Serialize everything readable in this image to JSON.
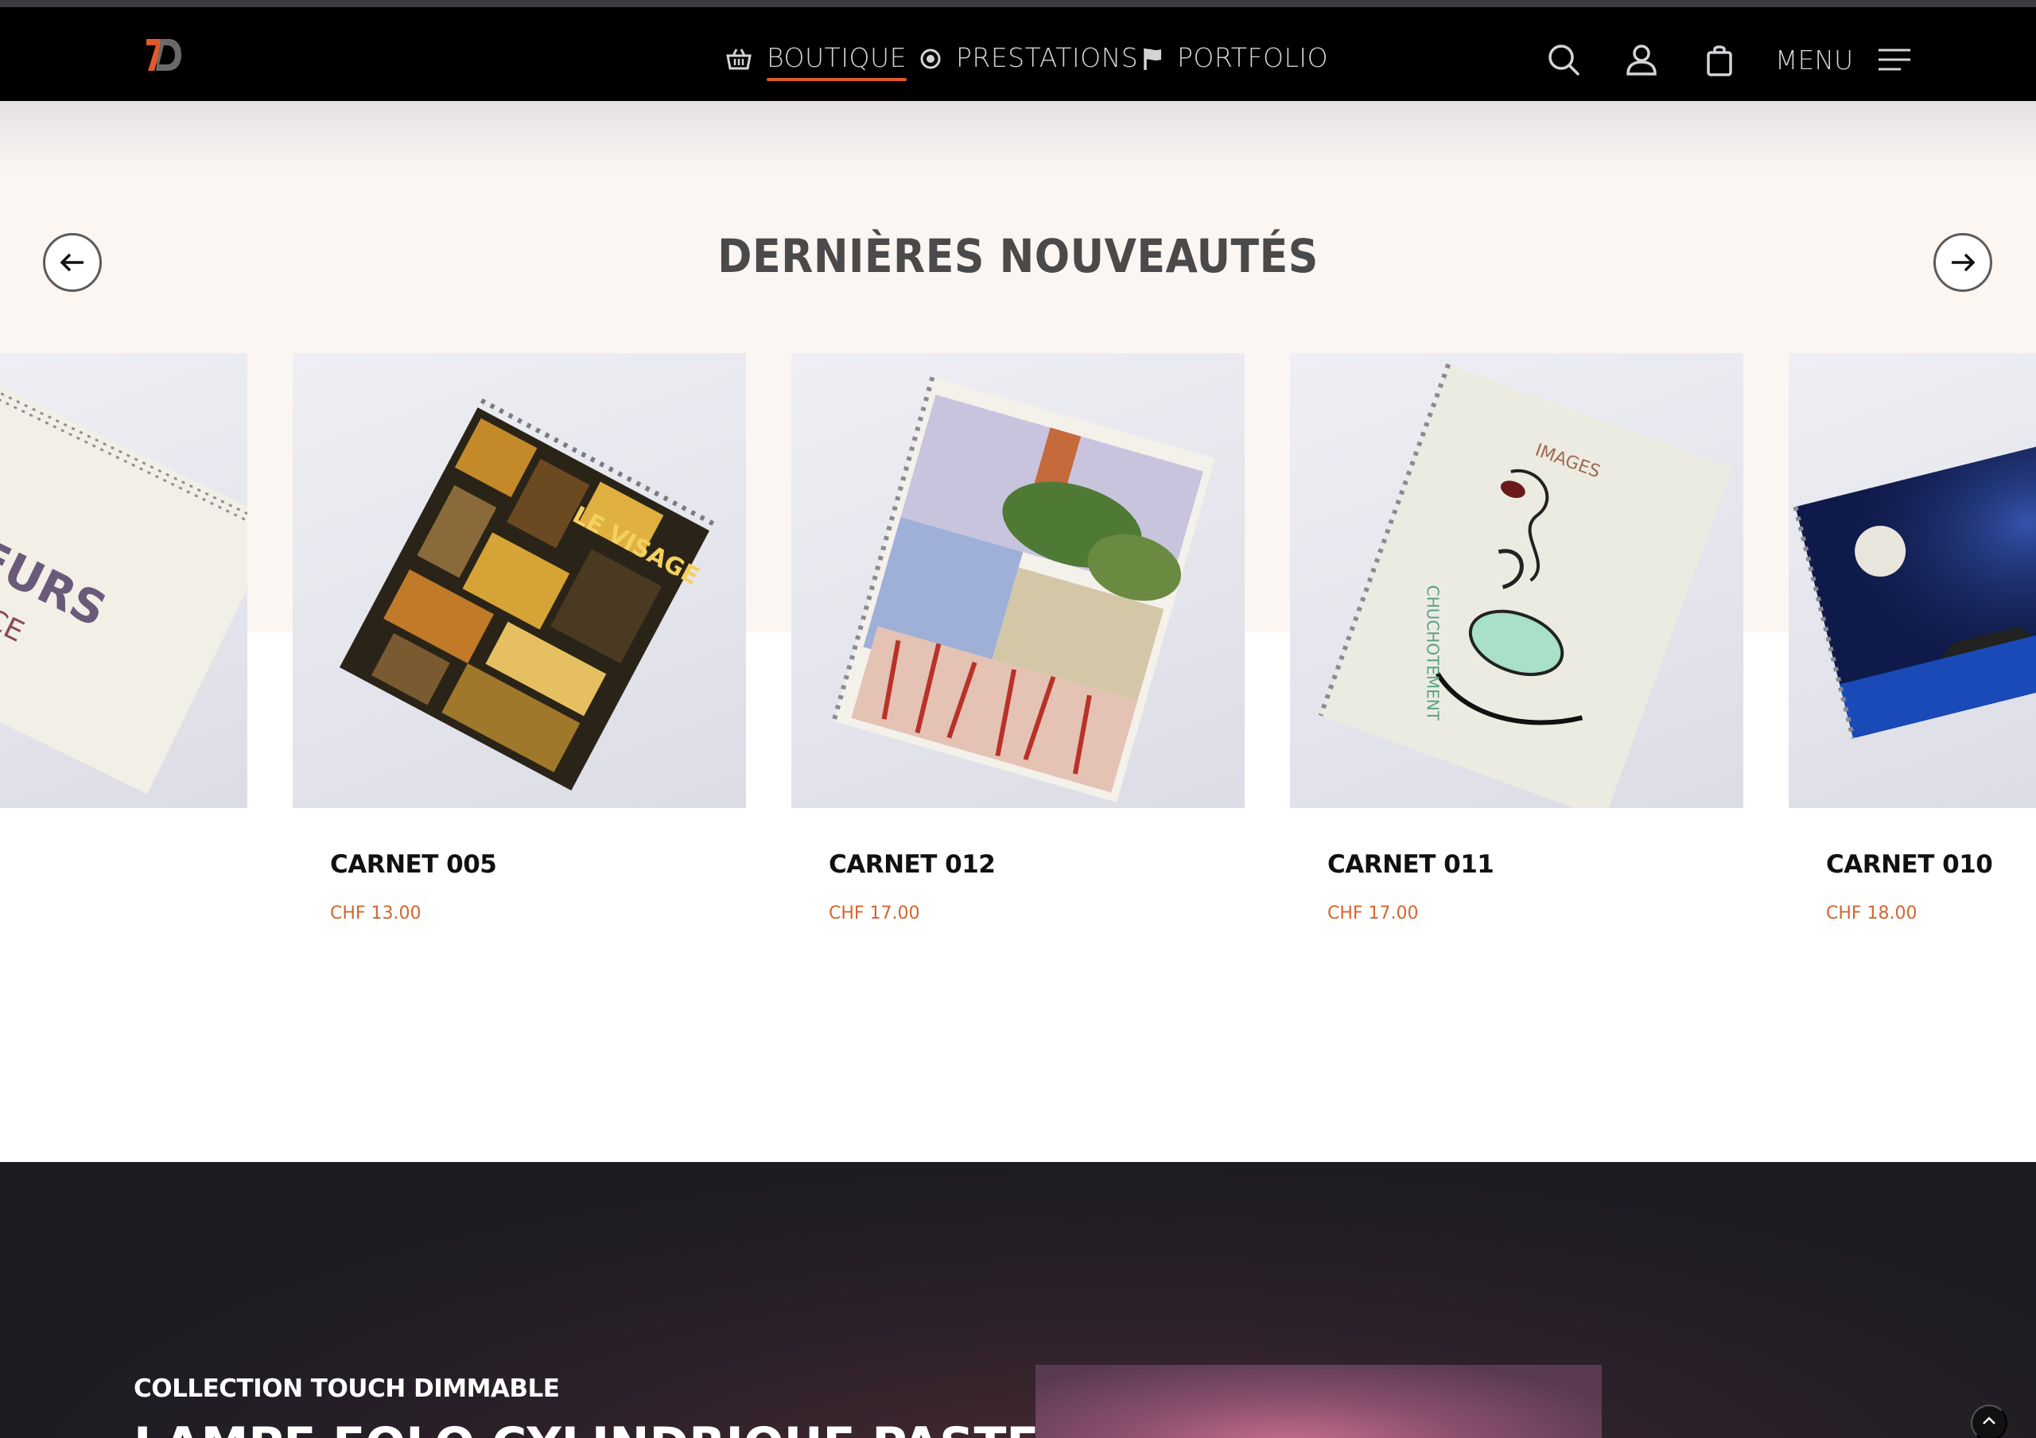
{
  "nav": {
    "links": [
      {
        "label": "BOUTIQUE",
        "icon": "basket-icon",
        "active": true
      },
      {
        "label": "PRESTATIONS",
        "icon": "target-icon",
        "active": false
      },
      {
        "label": "PORTFOLIO",
        "icon": "flag-icon",
        "active": false
      }
    ],
    "menu_label": "MENU",
    "icons": [
      "search-icon",
      "user-icon",
      "bag-icon",
      "hamburger-icon"
    ],
    "accent_color": "#e0592a"
  },
  "section": {
    "title": "DERNIÈRES NOUVEAUTÉS"
  },
  "products": [
    {
      "name": "",
      "price": "",
      "cover_text": "LEURS FORCE"
    },
    {
      "name": "CARNET 005",
      "price": "CHF 13.00",
      "cover_text": "LE VISAGE"
    },
    {
      "name": "CARNET 012",
      "price": "CHF 17.00",
      "cover_text": ""
    },
    {
      "name": "CARNET 011",
      "price": "CHF 17.00",
      "cover_text": "IMAGES CHUCHOTEMENT"
    },
    {
      "name": "CARNET 010",
      "price": "CHF 18.00",
      "cover_text": ""
    }
  ],
  "promo": {
    "subtitle": "COLLECTION TOUCH DIMMABLE",
    "title": "LAMPE EOLO CYLINDRIQUE PASTEL"
  },
  "colors": {
    "price": "#d4652d",
    "hero_bg": "#fcf6f3",
    "dark_bg": "#1c1b22"
  }
}
